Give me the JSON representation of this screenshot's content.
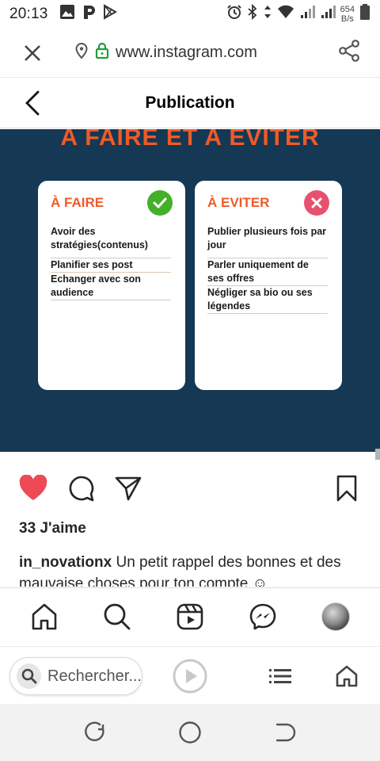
{
  "status_bar": {
    "time": "20:13",
    "net_speed_value": "654",
    "net_speed_unit": "B/s",
    "left_icons": [
      "gallery-icon",
      "p-app-icon",
      "play-store-icon"
    ],
    "right_icons": [
      "alarm-icon",
      "bluetooth-icon",
      "data-arrows-icon",
      "wifi-icon",
      "signal-icon",
      "signal-icon",
      "battery-icon"
    ]
  },
  "browser": {
    "url": "www.instagram.com",
    "search_placeholder": "Rechercher..."
  },
  "header": {
    "title": "Publication"
  },
  "post_image": {
    "headline": "A FAIRE ET A EVITER",
    "left_card": {
      "title": "À FAIRE",
      "items": [
        "Avoir des stratégies(contenus)",
        "Planifier ses post",
        "Echanger avec son audience"
      ]
    },
    "right_card": {
      "title": "À EVITER",
      "items": [
        "Publier plusieurs fois par jour",
        "Parler uniquement de ses offres",
        "Négliger sa bio ou ses légendes"
      ]
    },
    "colors": {
      "background": "#153854",
      "accent": "#f05a28",
      "ok": "#43b02a",
      "no": "#e8516e"
    }
  },
  "post": {
    "likes": "33 J'aime",
    "username": "in_novationx",
    "caption": " Un petit rappel des bonnes et des mauvaise choses pour ton compte ☺..."
  },
  "colors": {
    "like_red": "#ed4956"
  }
}
